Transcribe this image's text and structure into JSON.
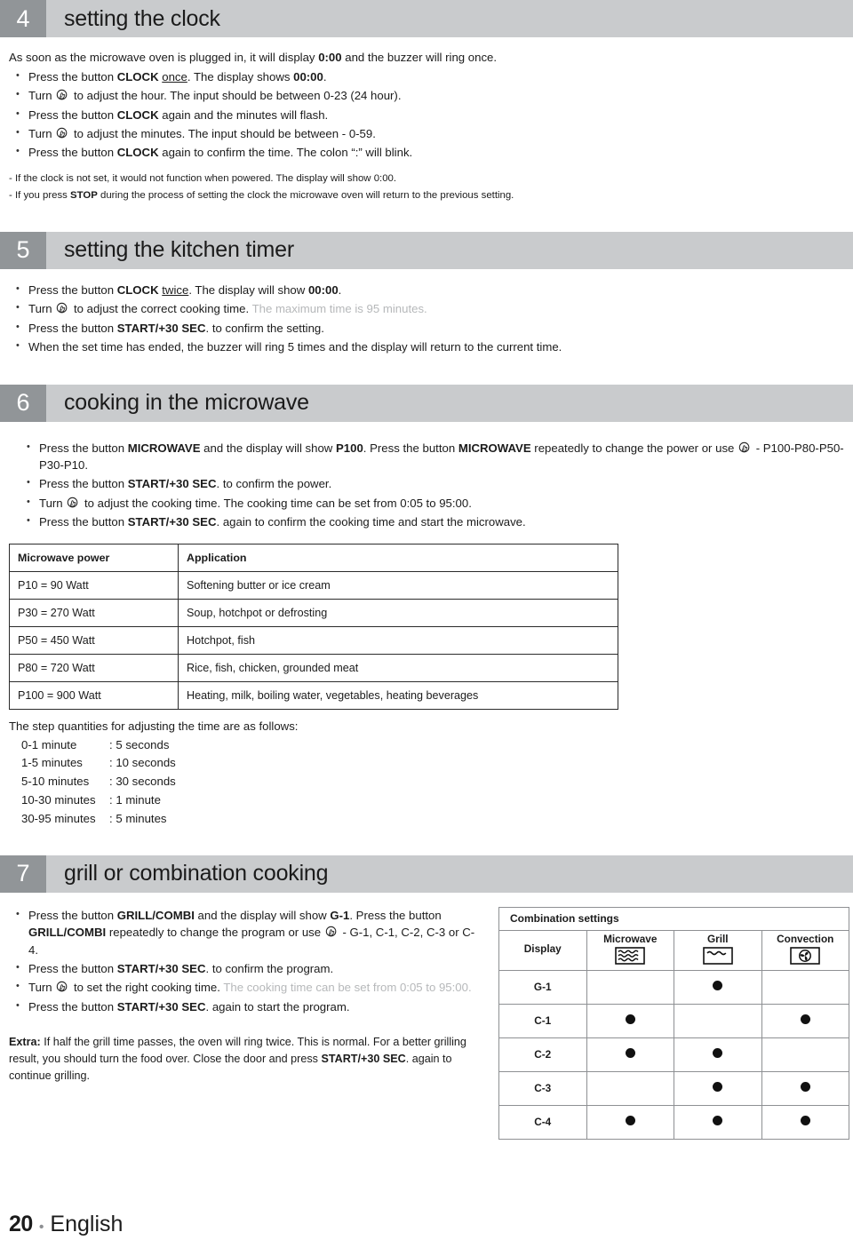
{
  "sections": [
    {
      "number": "4",
      "title": "setting the clock",
      "lead_parts": [
        {
          "t": "As soon as the microwave oven is plugged in, it will display  ",
          "s": "n"
        },
        {
          "t": "0:00",
          "s": "b"
        },
        {
          "t": " and the buzzer will ring once.",
          "s": "n"
        }
      ],
      "steps": [
        [
          {
            "t": "Press the button ",
            "s": "n"
          },
          {
            "t": "CLOCK",
            "s": "b"
          },
          {
            "t": " ",
            "s": "n"
          },
          {
            "t": "once",
            "s": "u"
          },
          {
            "t": ". The display shows ",
            "s": "n"
          },
          {
            "t": "00:00",
            "s": "b"
          },
          {
            "t": ".",
            "s": "n"
          }
        ],
        [
          {
            "t": "Turn ",
            "s": "n"
          },
          {
            "t": "",
            "s": "icon"
          },
          {
            "t": " to adjust the hour. The input should be between 0-23 (24 hour).",
            "s": "n"
          }
        ],
        [
          {
            "t": "Press the button ",
            "s": "n"
          },
          {
            "t": "CLOCK",
            "s": "b"
          },
          {
            "t": " again and the minutes will flash.",
            "s": "n"
          }
        ],
        [
          {
            "t": "Turn ",
            "s": "n"
          },
          {
            "t": "",
            "s": "icon"
          },
          {
            "t": " to adjust the minutes. The input should be between - 0-59.",
            "s": "n"
          }
        ],
        [
          {
            "t": "Press the button ",
            "s": "n"
          },
          {
            "t": "CLOCK",
            "s": "b"
          },
          {
            "t": " again to confirm the time. The colon “:” will blink.",
            "s": "n"
          }
        ]
      ],
      "notes": [
        [
          {
            "t": "- If the clock is not set, it would not function when powered. The display will show 0:00.",
            "s": "n"
          }
        ],
        [
          {
            "t": "- If you press ",
            "s": "n"
          },
          {
            "t": "STOP",
            "s": "b"
          },
          {
            "t": " during the process of setting the clock the microwave oven will return to the previous setting.",
            "s": "n"
          }
        ]
      ]
    },
    {
      "number": "5",
      "title": "setting the kitchen timer",
      "steps": [
        [
          {
            "t": "Press the button ",
            "s": "n"
          },
          {
            "t": "CLOCK",
            "s": "b"
          },
          {
            "t": " ",
            "s": "n"
          },
          {
            "t": "twice",
            "s": "u"
          },
          {
            "t": ". The display will show ",
            "s": "n"
          },
          {
            "t": "00:00",
            "s": "b"
          },
          {
            "t": ".",
            "s": "n"
          }
        ],
        [
          {
            "t": "Turn ",
            "s": "n"
          },
          {
            "t": "",
            "s": "icon"
          },
          {
            "t": " to adjust the correct cooking time. ",
            "s": "n"
          },
          {
            "t": "The maximum time is 95 minutes.",
            "s": "m"
          }
        ],
        [
          {
            "t": "Press the button ",
            "s": "n"
          },
          {
            "t": "START/+30 SEC",
            "s": "b"
          },
          {
            "t": ". to confirm the setting.",
            "s": "n"
          }
        ],
        [
          {
            "t": "When the set time has ended, the buzzer will ring 5 times and the display will return to the current time.",
            "s": "n"
          }
        ]
      ]
    },
    {
      "number": "6",
      "title": "cooking in the microwave",
      "steps": [
        [
          {
            "t": "Press the button ",
            "s": "n"
          },
          {
            "t": "MICROWAVE",
            "s": "b"
          },
          {
            "t": " and the display will show ",
            "s": "n"
          },
          {
            "t": "P100",
            "s": "b"
          },
          {
            "t": ". Press the button ",
            "s": "n"
          },
          {
            "t": "MICROWAVE",
            "s": "b"
          },
          {
            "t": " repeatedly to change the power or use ",
            "s": "n"
          },
          {
            "t": "",
            "s": "icon"
          },
          {
            "t": " - P100-P80-P50-P30-P10.",
            "s": "n"
          }
        ],
        [
          {
            "t": "Press the button ",
            "s": "n"
          },
          {
            "t": "START/+30 SEC",
            "s": "b"
          },
          {
            "t": ". to confirm the power.",
            "s": "n"
          }
        ],
        [
          {
            "t": "Turn ",
            "s": "n"
          },
          {
            "t": "",
            "s": "icon"
          },
          {
            "t": " to adjust the cooking time. The cooking time can be set from 0:05 to 95:00.",
            "s": "n"
          }
        ],
        [
          {
            "t": "Press the button ",
            "s": "n"
          },
          {
            "t": "START/+30 SEC",
            "s": "b"
          },
          {
            "t": ". again to confirm the cooking time and start the microwave.",
            "s": "n"
          }
        ]
      ]
    },
    {
      "number": "7",
      "title": "grill or combination cooking",
      "steps": [
        [
          {
            "t": "Press the button ",
            "s": "n"
          },
          {
            "t": "GRILL/COMBI",
            "s": "b"
          },
          {
            "t": " and the display will show ",
            "s": "n"
          },
          {
            "t": "G-1",
            "s": "b"
          },
          {
            "t": ". Press the button ",
            "s": "n"
          },
          {
            "t": "GRILL/COMBI",
            "s": "b"
          },
          {
            "t": " repeatedly to change the program or use ",
            "s": "n"
          },
          {
            "t": "",
            "s": "icon"
          },
          {
            "t": " - G-1, C-1, C-2, C-3 or C-4.",
            "s": "n"
          }
        ],
        [
          {
            "t": "Press the button ",
            "s": "n"
          },
          {
            "t": "START/+30 SEC",
            "s": "b"
          },
          {
            "t": ". to confirm the program.",
            "s": "n"
          }
        ],
        [
          {
            "t": "Turn ",
            "s": "n"
          },
          {
            "t": "",
            "s": "icon"
          },
          {
            "t": " to set the right cooking time. ",
            "s": "n"
          },
          {
            "t": "The cooking time can be set from 0:05 to 95:00.",
            "s": "m"
          }
        ],
        [
          {
            "t": "Press the button ",
            "s": "n"
          },
          {
            "t": "START/+30 SEC",
            "s": "b"
          },
          {
            "t": ". again to start the program.",
            "s": "n"
          }
        ]
      ],
      "extra": [
        {
          "t": "Extra:",
          "s": "b"
        },
        {
          "t": " If half the grill time passes, the oven will ring twice. This is normal. For a better grilling result, you should turn the food over.  Close the door and press ",
          "s": "n"
        },
        {
          "t": "START/+30 SEC",
          "s": "b"
        },
        {
          "t": ". again to continue grilling.",
          "s": "n"
        }
      ]
    }
  ],
  "power_table": {
    "headers": [
      "Microwave power",
      "Application"
    ],
    "rows": [
      [
        "P10 = 90 Watt",
        "Softening butter or ice cream"
      ],
      [
        "P30 = 270 Watt",
        "Soup, hotchpot or defrosting"
      ],
      [
        "P50 = 450 Watt",
        "Hotchpot, fish"
      ],
      [
        "P80 = 720 Watt",
        "Rice, fish, chicken, grounded meat"
      ],
      [
        "P100 = 900 Watt",
        "Heating, milk, boiling water, vegetables, heating beverages"
      ]
    ]
  },
  "step_quantities": {
    "intro": "The step quantities for adjusting the time are as follows:",
    "rows": [
      {
        "range": "0-1 minute",
        "step": ": 5 seconds"
      },
      {
        "range": "1-5 minutes",
        "step": ": 10 seconds"
      },
      {
        "range": "5-10 minutes",
        "step": ": 30 seconds"
      },
      {
        "range": "10-30 minutes",
        "step": ": 1 minute"
      },
      {
        "range": "30-95 minutes",
        "step": ": 5 minutes"
      }
    ]
  },
  "combination_table": {
    "title": "Combination settings",
    "columns": [
      {
        "label": "Display",
        "icon": ""
      },
      {
        "label": "Microwave",
        "icon": "microwave-icon"
      },
      {
        "label": "Grill",
        "icon": "grill-icon"
      },
      {
        "label": "Convection",
        "icon": "convection-icon"
      }
    ],
    "rows": [
      {
        "display": "G-1",
        "microwave": false,
        "grill": true,
        "convection": false
      },
      {
        "display": "C-1",
        "microwave": true,
        "grill": false,
        "convection": true
      },
      {
        "display": "C-2",
        "microwave": true,
        "grill": true,
        "convection": false
      },
      {
        "display": "C-3",
        "microwave": false,
        "grill": true,
        "convection": true
      },
      {
        "display": "C-4",
        "microwave": true,
        "grill": true,
        "convection": true
      }
    ]
  },
  "footer": {
    "page": "20",
    "separator": "•",
    "language": "English"
  },
  "colors": {
    "header_bar": "#c9cbcd",
    "header_number": "#919598",
    "text": "#1b1b1b",
    "muted_text": "#b6b8ba",
    "table_border": "#2b2b2b",
    "combo_border": "#8e9093"
  }
}
